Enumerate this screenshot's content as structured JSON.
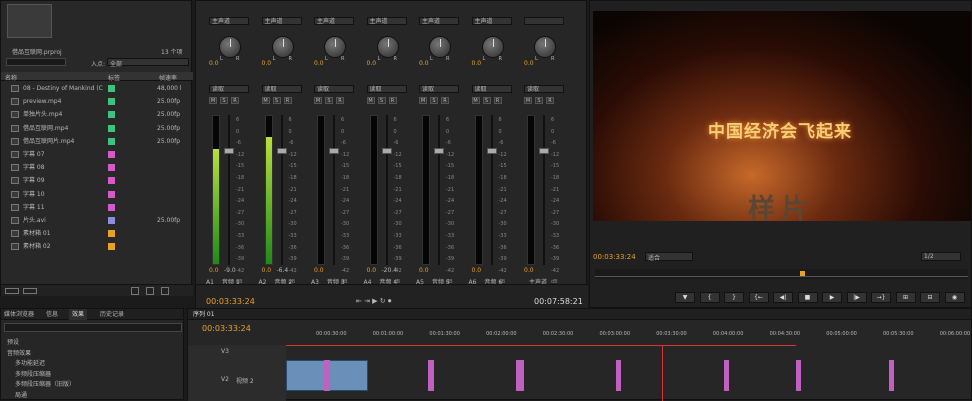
{
  "project": {
    "file_name": "借品互联网.prproj",
    "item_count": "13 个项",
    "in_point_label": "入点:",
    "in_point_value": "全部",
    "col_name": "名称",
    "col_label": "标签",
    "col_rate": "帧速率",
    "items": [
      {
        "name": "08 - Destiny of Mankind (C",
        "color": "#3cc47a",
        "rate": "48,000 l"
      },
      {
        "name": "preview.mp4",
        "color": "#3cc47a",
        "rate": "25.00fp"
      },
      {
        "name": "单独片头.mp4",
        "color": "#3cc47a",
        "rate": "25.00fp"
      },
      {
        "name": "借品互联网.mp4",
        "color": "#3cc47a",
        "rate": "25.00fp"
      },
      {
        "name": "借品互联网片.mp4",
        "color": "#3cc47a",
        "rate": "25.00fp"
      },
      {
        "name": "字幕 07",
        "color": "#d35ac8",
        "rate": ""
      },
      {
        "name": "字幕 08",
        "color": "#d35ac8",
        "rate": ""
      },
      {
        "name": "字幕 09",
        "color": "#d35ac8",
        "rate": ""
      },
      {
        "name": "字幕 10",
        "color": "#d35ac8",
        "rate": ""
      },
      {
        "name": "字幕 11",
        "color": "#d35ac8",
        "rate": ""
      },
      {
        "name": "片头.avi",
        "color": "#8a8fd9",
        "rate": "25.00fp"
      },
      {
        "name": "素材箱 01",
        "color": "#e8a227",
        "rate": ""
      },
      {
        "name": "素材箱 02",
        "color": "#e8a227",
        "rate": ""
      }
    ]
  },
  "mixer": {
    "channels": [
      {
        "route": "主声道",
        "value": "0.0",
        "mode": "读取",
        "meter": 0.78,
        "peak": "-9.0",
        "id": "A1",
        "name": "音频 1"
      },
      {
        "route": "主声道",
        "value": "0.0",
        "mode": "读取",
        "meter": 0.86,
        "peak": "-6.4",
        "id": "A2",
        "name": "音频 2"
      },
      {
        "route": "主声道",
        "value": "0.0",
        "mode": "读取",
        "meter": 0,
        "peak": "",
        "id": "A3",
        "name": "音频 3"
      },
      {
        "route": "主声道",
        "value": "0.0",
        "mode": "读取",
        "meter": 0,
        "peak": "-20.4",
        "id": "A4",
        "name": "音频 4"
      },
      {
        "route": "主声道",
        "value": "0.0",
        "mode": "读取",
        "meter": 0,
        "peak": "",
        "id": "A5",
        "name": "音频 5"
      },
      {
        "route": "主声道",
        "value": "0.0",
        "mode": "读取",
        "meter": 0,
        "peak": "",
        "id": "A6",
        "name": "音频 6"
      },
      {
        "route": "",
        "value": "0.0",
        "mode": "读取",
        "meter": 0,
        "peak": "",
        "id": "",
        "name": "主声道"
      }
    ],
    "scale": [
      "6",
      "0",
      "-6",
      "-12",
      "-15",
      "-18",
      "-21",
      "-24",
      "-27",
      "-30",
      "-33",
      "-36",
      "-39",
      "-42",
      "dB"
    ],
    "timecode_left": "00:03:33:24",
    "timecode_right": "00:07:58:21"
  },
  "monitor": {
    "title_text": "中国经济会飞起来",
    "watermark": "样片",
    "timecode": "00:03:33:24",
    "fit": "适合",
    "ratio": "1/2",
    "timecode_right": "00:0"
  },
  "effects": {
    "tabs": [
      "媒体浏览器",
      "信息",
      "效果",
      "历史记录"
    ],
    "items": [
      "预设",
      "音频效果",
      "多功能延迟",
      "多频段压缩器",
      "多频段压缩器（旧版）",
      "局通"
    ]
  },
  "timeline": {
    "tab": "序列 01",
    "timecode": "00:03:33:24",
    "ruler": [
      "00:00:30:00",
      "00:01:00:00",
      "00:01:30:00",
      "00:02:00:00",
      "00:02:30:00",
      "00:03:00:00",
      "00:03:30:00",
      "00:04:00:00",
      "00:04:30:00",
      "00:05:00:00",
      "00:05:30:00",
      "00:06:00:00"
    ],
    "tracks": [
      "V3",
      "V2",
      "视频 2"
    ]
  }
}
